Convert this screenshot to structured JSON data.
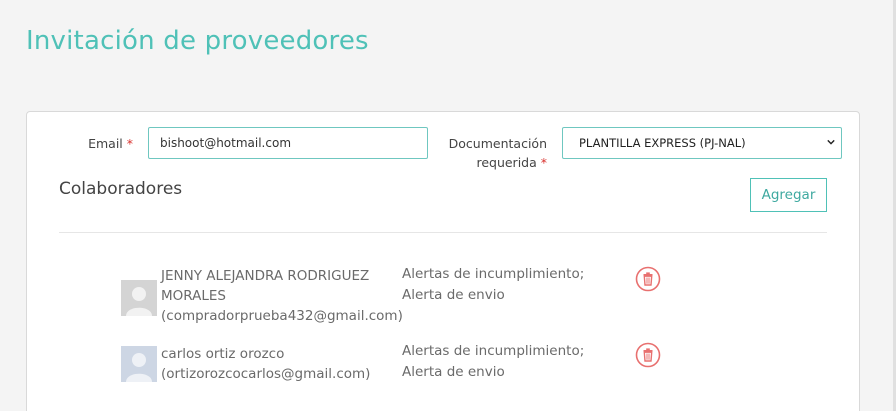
{
  "page": {
    "title": "Invitación de proveedores"
  },
  "form": {
    "email_label": "Email",
    "email_value": "bishoot@hotmail.com",
    "doc_label_line1": "Documentación",
    "doc_label_line2": "requerida",
    "required_mark": "*",
    "doc_selected": "PLANTILLA EXPRESS (PJ-NAL)"
  },
  "collaborators": {
    "title": "Colaboradores",
    "add_label": "Agregar",
    "items": [
      {
        "name_line1": "JENNY ALEJANDRA RODRIGUEZ",
        "name_line2": "MORALES",
        "email": "(compradorprueba432@gmail.com)",
        "alerts_line1": "Alertas de incumplimiento;",
        "alerts_line2": "Alerta de envio"
      },
      {
        "name_line1": "carlos ortiz orozco",
        "email": "(ortizorozcocarlos@gmail.com)",
        "alerts_line1": "Alertas de incumplimiento;",
        "alerts_line2": "Alerta de envio"
      }
    ]
  },
  "colors": {
    "accent": "#4fc1b7",
    "danger": "#e8706f",
    "required": "#d9312d"
  }
}
